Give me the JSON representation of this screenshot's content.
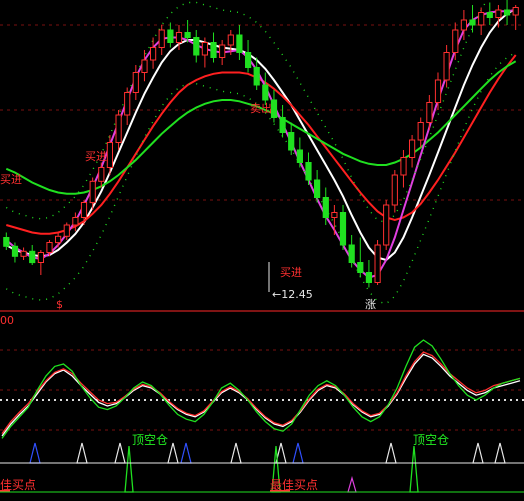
{
  "chart_data": [
    {
      "type": "candlestick",
      "title": "",
      "ylabel": "",
      "annotations": {
        "low_price": "12.45",
        "buy_signal": "买进",
        "sell_signal": "卖出",
        "divider_left": "$",
        "divider_right": "涨"
      },
      "colors": {
        "up": "#ff3030",
        "down": "#20e020",
        "bg": "#000000"
      },
      "ohlc": [
        [
          130,
          134,
          120,
          123
        ],
        [
          123,
          126,
          110,
          115
        ],
        [
          115,
          122,
          112,
          119
        ],
        [
          119,
          124,
          108,
          110
        ],
        [
          110,
          120,
          100,
          118
        ],
        [
          118,
          128,
          115,
          126
        ],
        [
          126,
          134,
          122,
          131
        ],
        [
          131,
          142,
          128,
          140
        ],
        [
          140,
          150,
          135,
          146
        ],
        [
          146,
          160,
          140,
          158
        ],
        [
          158,
          178,
          152,
          175
        ],
        [
          175,
          190,
          170,
          186
        ],
        [
          186,
          212,
          180,
          206
        ],
        [
          206,
          232,
          200,
          228
        ],
        [
          228,
          250,
          220,
          246
        ],
        [
          246,
          268,
          240,
          262
        ],
        [
          262,
          280,
          255,
          272
        ],
        [
          272,
          290,
          265,
          282
        ],
        [
          282,
          300,
          276,
          296
        ],
        [
          296,
          302,
          282,
          286
        ],
        [
          286,
          300,
          280,
          294
        ],
        [
          294,
          304,
          286,
          290
        ],
        [
          290,
          296,
          270,
          276
        ],
        [
          276,
          290,
          266,
          286
        ],
        [
          286,
          294,
          270,
          274
        ],
        [
          274,
          288,
          268,
          284
        ],
        [
          284,
          296,
          276,
          292
        ],
        [
          292,
          300,
          272,
          278
        ],
        [
          278,
          288,
          262,
          266
        ],
        [
          266,
          274,
          248,
          252
        ],
        [
          252,
          262,
          236,
          240
        ],
        [
          240,
          248,
          222,
          226
        ],
        [
          226,
          236,
          210,
          214
        ],
        [
          214,
          222,
          196,
          200
        ],
        [
          200,
          210,
          186,
          190
        ],
        [
          190,
          198,
          172,
          176
        ],
        [
          176,
          184,
          158,
          162
        ],
        [
          162,
          170,
          140,
          146
        ],
        [
          146,
          156,
          132,
          150
        ],
        [
          150,
          156,
          120,
          124
        ],
        [
          124,
          132,
          106,
          110
        ],
        [
          110,
          130,
          98,
          102
        ],
        [
          102,
          112,
          90,
          94
        ],
        [
          94,
          128,
          92,
          124
        ],
        [
          124,
          160,
          120,
          156
        ],
        [
          156,
          184,
          150,
          180
        ],
        [
          180,
          200,
          170,
          194
        ],
        [
          194,
          212,
          186,
          208
        ],
        [
          208,
          226,
          202,
          222
        ],
        [
          222,
          244,
          216,
          238
        ],
        [
          238,
          262,
          232,
          256
        ],
        [
          256,
          284,
          250,
          278
        ],
        [
          278,
          302,
          272,
          296
        ],
        [
          296,
          312,
          288,
          304
        ],
        [
          304,
          316,
          294,
          300
        ],
        [
          300,
          314,
          292,
          310
        ],
        [
          310,
          318,
          300,
          306
        ],
        [
          306,
          316,
          298,
          312
        ],
        [
          312,
          320,
          300,
          308
        ],
        [
          308,
          316,
          296,
          314
        ]
      ],
      "ma_series": [
        {
          "color": "#ffffff",
          "values": [
            124,
            120,
            118,
            116,
            115,
            116,
            120,
            126,
            133,
            142,
            154,
            167,
            182,
            198,
            214,
            230,
            245,
            258,
            270,
            279,
            285,
            288,
            288,
            286,
            284,
            282,
            281,
            280,
            277,
            272,
            265,
            256,
            246,
            236,
            224,
            212,
            200,
            188,
            176,
            163,
            148,
            134,
            122,
            114,
            112,
            118,
            130,
            146,
            163,
            180,
            198,
            216,
            234,
            252,
            268,
            282,
            294,
            303,
            309,
            313
          ]
        },
        {
          "color": "#ff2020",
          "values": [
            140,
            138,
            136,
            134,
            133,
            133,
            134,
            136,
            139,
            143,
            149,
            156,
            165,
            175,
            186,
            197,
            208,
            219,
            229,
            238,
            246,
            252,
            256,
            259,
            261,
            262,
            262,
            262,
            261,
            258,
            254,
            249,
            243,
            236,
            228,
            220,
            211,
            202,
            193,
            184,
            175,
            166,
            158,
            151,
            146,
            144,
            146,
            150,
            157,
            166,
            176,
            187,
            198,
            210,
            222,
            234,
            246,
            257,
            267,
            276
          ]
        },
        {
          "color": "#20e020",
          "values": [
            185,
            182,
            178,
            174,
            171,
            168,
            166,
            165,
            165,
            166,
            168,
            171,
            175,
            180,
            186,
            192,
            199,
            206,
            213,
            219,
            225,
            230,
            234,
            237,
            239,
            240,
            240,
            239,
            237,
            235,
            232,
            229,
            225,
            221,
            217,
            213,
            209,
            205,
            201,
            197,
            194,
            191,
            189,
            188,
            188,
            190,
            193,
            197,
            202,
            208,
            214,
            221,
            228,
            235,
            242,
            249,
            256,
            262,
            267,
            271
          ]
        },
        {
          "color": "#e040e0",
          "values": [
            128,
            122,
            118,
            114,
            113,
            117,
            124,
            133,
            143,
            156,
            170,
            186,
            204,
            222,
            240,
            258,
            272,
            282,
            289,
            290,
            290,
            288,
            284,
            281,
            279,
            278,
            279,
            280,
            274,
            264,
            251,
            236,
            221,
            206,
            191,
            176,
            161,
            147,
            136,
            124,
            112,
            104,
            98,
            100,
            112,
            130,
            152,
            174,
            196,
            218,
            240,
            260,
            280,
            296,
            304,
            308,
            310,
            311,
            311,
            312
          ]
        }
      ]
    },
    {
      "type": "line",
      "title": "",
      "y_label_partial": "00",
      "annotations": {
        "top_empty": "顶空仓",
        "best_buy": "最佳买点",
        "best_buy_left": "佳买点"
      },
      "series": [
        {
          "color": "#ffffff",
          "values": [
            20,
            30,
            38,
            45,
            55,
            65,
            72,
            75,
            70,
            62,
            55,
            48,
            45,
            47,
            52,
            58,
            62,
            60,
            55,
            48,
            42,
            38,
            36,
            40,
            48,
            56,
            60,
            56,
            50,
            42,
            35,
            30,
            28,
            32,
            40,
            50,
            58,
            62,
            60,
            54,
            46,
            40,
            36,
            38,
            45,
            55,
            68,
            80,
            88,
            85,
            78,
            70,
            64,
            58,
            54,
            56,
            60,
            62,
            64,
            66
          ]
        },
        {
          "color": "#ff3030",
          "values": [
            22,
            32,
            40,
            47,
            57,
            66,
            73,
            76,
            72,
            64,
            57,
            50,
            47,
            48,
            53,
            59,
            63,
            61,
            56,
            49,
            43,
            39,
            37,
            41,
            49,
            57,
            61,
            57,
            51,
            43,
            36,
            31,
            29,
            33,
            41,
            51,
            59,
            63,
            61,
            55,
            47,
            41,
            37,
            39,
            46,
            56,
            70,
            82,
            90,
            87,
            80,
            72,
            66,
            60,
            56,
            58,
            62,
            64,
            66,
            68
          ]
        },
        {
          "color": "#20e020",
          "values": [
            18,
            28,
            36,
            44,
            58,
            70,
            78,
            80,
            74,
            62,
            52,
            44,
            42,
            45,
            52,
            60,
            65,
            62,
            55,
            46,
            38,
            34,
            32,
            38,
            48,
            60,
            64,
            58,
            50,
            40,
            32,
            26,
            24,
            30,
            42,
            54,
            62,
            66,
            62,
            54,
            44,
            36,
            32,
            36,
            46,
            60,
            78,
            94,
            100,
            95,
            84,
            72,
            62,
            54,
            50,
            54,
            60,
            64,
            66,
            68
          ]
        }
      ],
      "dotted_line_value": 50
    }
  ]
}
